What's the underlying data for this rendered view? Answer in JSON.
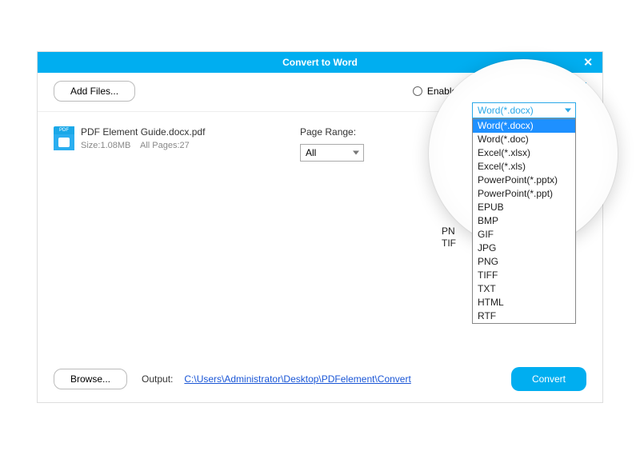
{
  "window": {
    "title": "Convert to Word"
  },
  "toolbar": {
    "add_files": "Add Files...",
    "enable_ocr": "Enable OCR",
    "format_selected": "Word(*.docx)"
  },
  "file": {
    "name": "PDF Element Guide.docx.pdf",
    "size": "Size:1.08MB",
    "pages": "All Pages:27",
    "icon_top": "PDF"
  },
  "range": {
    "label": "Page Range:",
    "value": "All"
  },
  "footer": {
    "browse": "Browse...",
    "output_label": "Output:",
    "output_path": "C:\\Users\\Administrator\\Desktop\\PDFelement\\Convert",
    "convert": "Convert"
  },
  "dropdown": {
    "selected": "Word(*.docx)",
    "options": [
      "Word(*.docx)",
      "Word(*.doc)",
      "Excel(*.xlsx)",
      "Excel(*.xls)",
      "PowerPoint(*.pptx)",
      "PowerPoint(*.ppt)",
      "EPUB",
      "BMP",
      "GIF",
      "JPG",
      "PNG",
      "TIFF",
      "TXT",
      "HTML",
      "RTF"
    ]
  },
  "fragments": {
    "pn": "PN",
    "tif": "TIF"
  }
}
